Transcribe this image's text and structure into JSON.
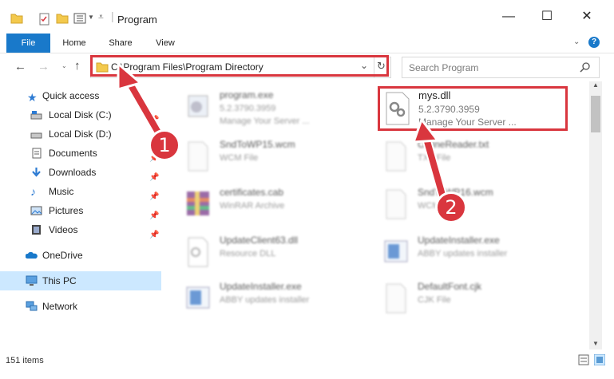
{
  "window": {
    "title": "Program",
    "controls": {
      "minimize": "—",
      "maximize": "☐",
      "close": "✕"
    }
  },
  "ribbon": {
    "tabs": [
      "File",
      "Home",
      "Share",
      "View"
    ],
    "collapse_icon": "chevron-down-icon",
    "help": "?"
  },
  "address": {
    "path": "C:\\Program Files\\Program Directory",
    "search_placeholder": "Search Program"
  },
  "sidebar": {
    "items": [
      {
        "label": "Quick access",
        "icon": "star-icon",
        "pinned": false
      },
      {
        "label": "Local Disk (C:)",
        "icon": "drive-icon",
        "pinned": true
      },
      {
        "label": "Local Disk (D:)",
        "icon": "drive-icon",
        "pinned": true
      },
      {
        "label": "Documents",
        "icon": "documents-icon",
        "pinned": true
      },
      {
        "label": "Downloads",
        "icon": "downloads-icon",
        "pinned": true
      },
      {
        "label": "Music",
        "icon": "music-icon",
        "pinned": true
      },
      {
        "label": "Pictures",
        "icon": "pictures-icon",
        "pinned": true
      },
      {
        "label": "Videos",
        "icon": "videos-icon",
        "pinned": true
      },
      {
        "label": "OneDrive",
        "icon": "cloud-icon",
        "pinned": false
      },
      {
        "label": "This PC",
        "icon": "computer-icon",
        "pinned": false,
        "selected": true
      },
      {
        "label": "Network",
        "icon": "network-icon",
        "pinned": false
      }
    ]
  },
  "files": [
    {
      "name": "program.exe",
      "line2": "5.2.3790.3959",
      "line3": "Manage Your Server ...",
      "blurred": true
    },
    {
      "name": "mys.dll",
      "line2": "5.2.3790.3959",
      "line3": "Manage Your Server ...",
      "blurred": false,
      "highlighted": true
    },
    {
      "name": "SndToWP15.wcm",
      "line2": "WCM File",
      "line3": "",
      "blurred": true
    },
    {
      "name": "OfflineReader.txt",
      "line2": "TXT File",
      "line3": "",
      "blurred": true
    },
    {
      "name": "certificates.cab",
      "line2": "WinRAR Archive",
      "line3": "",
      "blurred": true
    },
    {
      "name": "SndToWP16.wcm",
      "line2": "WCM File",
      "line3": "",
      "blurred": true
    },
    {
      "name": "UpdateClient63.dll",
      "line2": "Resource DLL",
      "line3": "",
      "blurred": true
    },
    {
      "name": "UpdateInstaller.exe",
      "line2": "ABBY updates installer",
      "line3": "",
      "blurred": true
    },
    {
      "name": "UpdateInstaller.exe",
      "line2": "ABBY updates installer",
      "line3": "",
      "blurred": true
    },
    {
      "name": "DefaultFont.cjk",
      "line2": "CJK File",
      "line3": "",
      "blurred": true
    }
  ],
  "status": {
    "count": "151 items"
  },
  "callouts": {
    "one": "1",
    "two": "2"
  },
  "colors": {
    "accent": "#1979ca",
    "highlight": "#d9363e"
  }
}
